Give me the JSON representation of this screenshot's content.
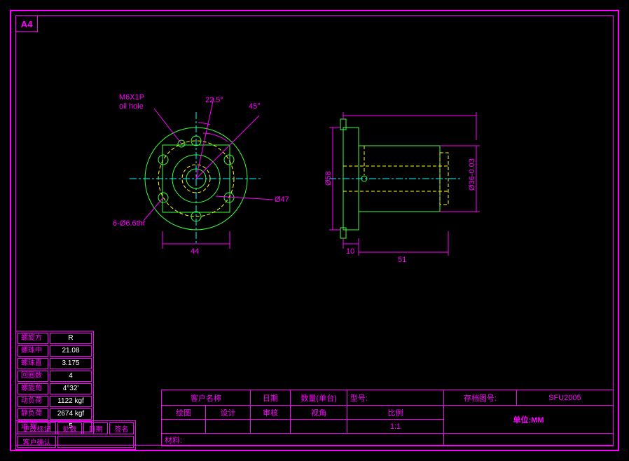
{
  "sheet_size": "A4",
  "annotations": {
    "oil_hole_1": "M6X1P",
    "oil_hole_2": "oil hole",
    "bolt_holes": "6-Ø6.6thr"
  },
  "dimensions": {
    "angle_225": "22.5°",
    "angle_45": "45°",
    "d47": "Ø47",
    "d58": "Ø58",
    "d36": "Ø36-0.03",
    "w44": "44",
    "w10": "10",
    "w51": "51"
  },
  "spec_table": [
    {
      "label": "螺旋方",
      "value": "R"
    },
    {
      "label": "螺珠中",
      "value": "21.08"
    },
    {
      "label": "螺珠直",
      "value": "3.175"
    },
    {
      "label": "回圈数",
      "value": "4"
    },
    {
      "label": "螺旋角",
      "value": "4°32'"
    },
    {
      "label": "动负荷",
      "value": "1122 kgf"
    },
    {
      "label": "静负荷",
      "value": "2674 kgf"
    },
    {
      "label": "道  程",
      "value": "5"
    }
  ],
  "change_table": {
    "row1": [
      "更改标记",
      "处数",
      "日期",
      "签名"
    ],
    "row2": [
      "客户确认",
      "",
      "",
      ""
    ]
  },
  "title_block": {
    "customer_name_lbl": "客户名称",
    "date_lbl": "日期",
    "qty_lbl": "数量(单台)",
    "model_lbl": "型号:",
    "drawing_no_lbl": "存档图号:",
    "drawing_no": "SFU2005",
    "draw_lbl": "绘图",
    "design_lbl": "设计",
    "check_lbl": "审核",
    "view_lbl": "视角",
    "scale_lbl": "比例",
    "scale_val": "1:1",
    "material_lbl": "材料:",
    "unit": "单位:MM"
  }
}
